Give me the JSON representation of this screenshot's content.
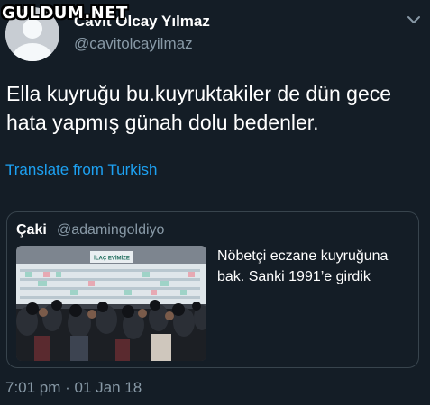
{
  "watermark": {
    "text": "GULDUM.NET"
  },
  "author": {
    "name": "Cavit Olcay Yılmaz",
    "handle": "@cavitolcayilmaz"
  },
  "tweet": {
    "text": "Ella kuyruğu bu.kuyruktakiler de dün gece hata yapmış günah dolu bedenler.",
    "translate_label": "Translate from Turkish",
    "timestamp": "7:01 pm · 01 Jan 18"
  },
  "quoted": {
    "name": "Çaki",
    "handle": "@adamingoldiyo",
    "text": "Nöbetçi eczane kuyruğuna bak. Sanki 1991’e girdik",
    "image_sign": "İLAÇ EVİMİZE"
  },
  "icons": {
    "menu": "chevron-down-icon",
    "avatar": "default-avatar"
  },
  "colors": {
    "background": "#141d26",
    "secondary_text": "#8899a6",
    "link": "#1da1f2",
    "border": "#38444d"
  }
}
